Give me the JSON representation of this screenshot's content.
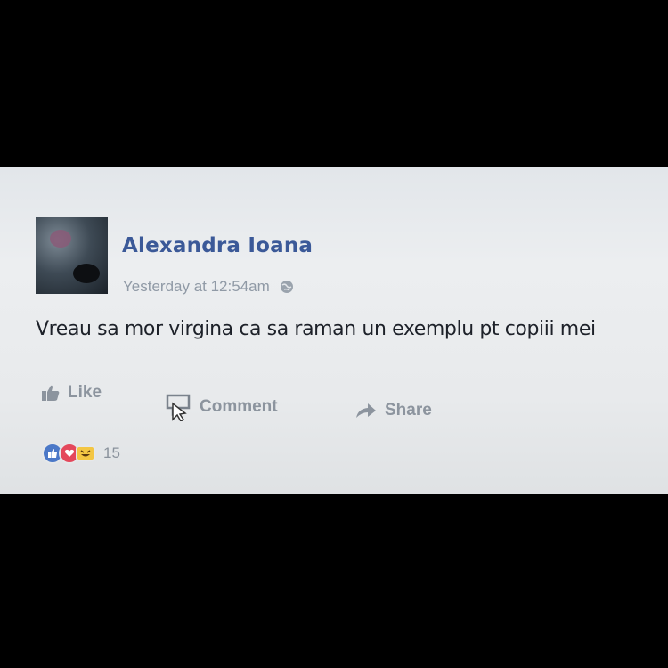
{
  "post": {
    "author": "Alexandra Ioana",
    "timestamp": "Yesterday at 12:54am",
    "privacy_icon": "globe-icon",
    "text": "Vreau sa mor virgina ca sa raman un exemplu pt copiii mei"
  },
  "actions": {
    "like": "Like",
    "comment": "Comment",
    "share": "Share"
  },
  "reactions": {
    "types": [
      "like",
      "love",
      "haha"
    ],
    "count": "15"
  },
  "colors": {
    "author": "#3b5998",
    "meta": "#909aa6",
    "action": "#8c949e",
    "like": "#4b78c7",
    "love": "#e4485b",
    "haha": "#f3c643"
  }
}
